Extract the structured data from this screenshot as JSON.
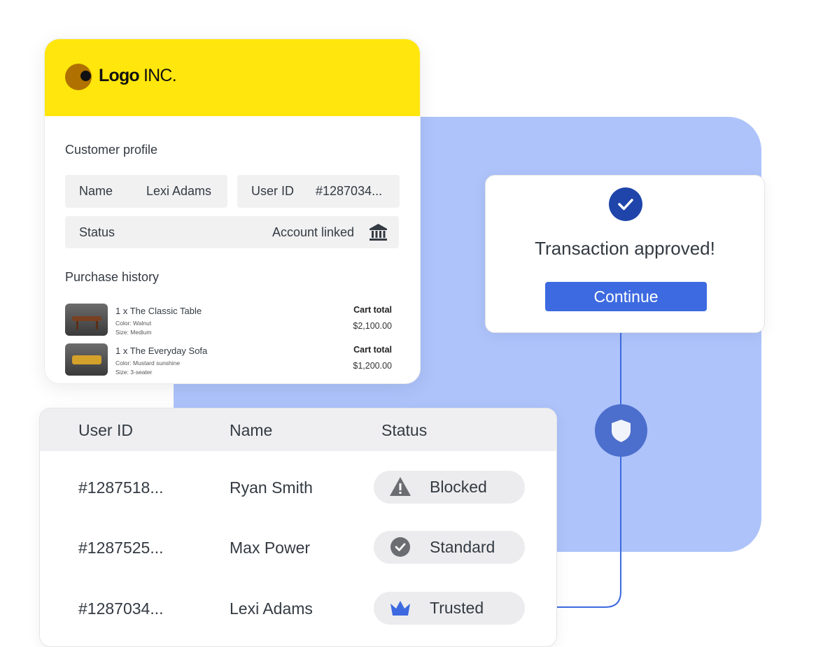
{
  "logo": {
    "bold": "Logo",
    "rest": " INC."
  },
  "profile": {
    "title": "Customer profile",
    "name_label": "Name",
    "name_value": "Lexi Adams",
    "userid_label": "User ID",
    "userid_value": "#1287034...",
    "status_label": "Status",
    "status_value": "Account linked",
    "status_icon": "bank-icon"
  },
  "purchase_history": {
    "title": "Purchase history",
    "items": [
      {
        "title": "1 x The Classic Table",
        "color": "Color: Walnut",
        "size": "Size: Medium",
        "total_label": "Cart total",
        "total": "$2,100.00"
      },
      {
        "title": "1 x The Everyday Sofa",
        "color": "Color: Mustard sunshine",
        "size": "Size: 3-seater",
        "total_label": "Cart total",
        "total": "$1,200.00"
      }
    ]
  },
  "approval": {
    "icon": "check-icon",
    "message": "Transaction approved!",
    "button": "Continue"
  },
  "users_table": {
    "headers": [
      "User ID",
      "Name",
      "Status"
    ],
    "rows": [
      {
        "id": "#1287518...",
        "name": "Ryan Smith",
        "status": "Blocked",
        "icon": "warning-icon"
      },
      {
        "id": "#1287525...",
        "name": "Max Power",
        "status": "Standard",
        "icon": "check-circle-icon"
      },
      {
        "id": "#1287034...",
        "name": "Lexi Adams",
        "status": "Trusted",
        "icon": "crown-icon"
      }
    ]
  },
  "colors": {
    "brand_yellow": "#ffe60c",
    "panel_blue": "#adc3fa",
    "accent_blue": "#3d6ae0",
    "dark_blue": "#1f45aa"
  }
}
